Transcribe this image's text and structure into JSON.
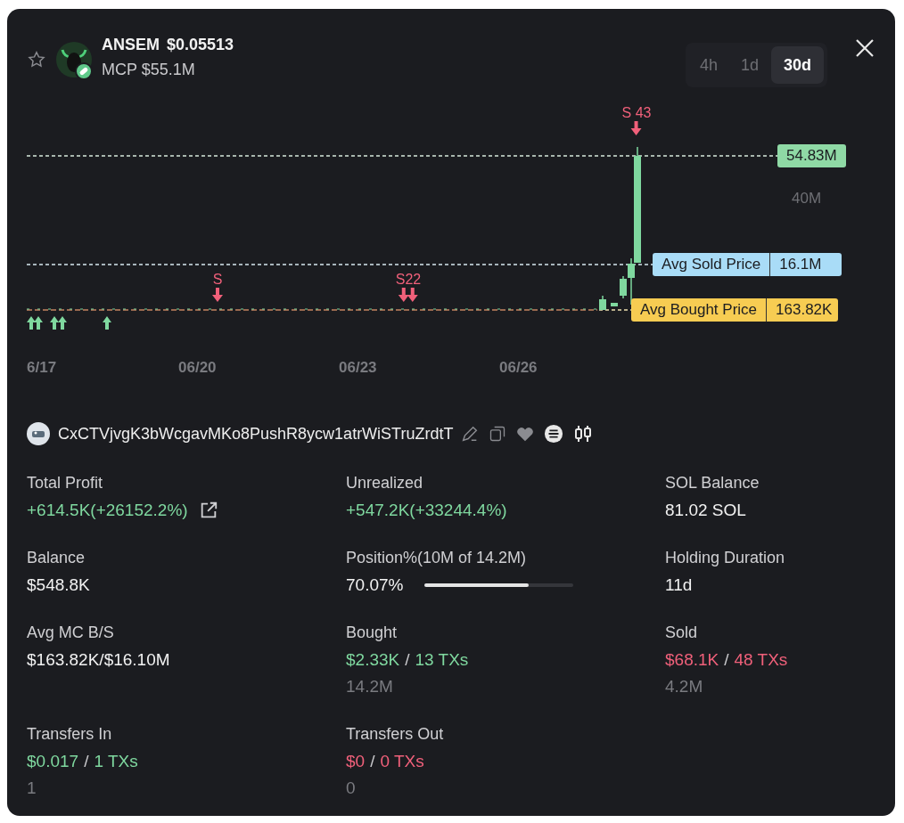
{
  "header": {
    "symbol": "ANSEM",
    "price": "$0.05513",
    "market_cap": "MCP $55.1M"
  },
  "timeframes": [
    {
      "label": "4h",
      "selected": false
    },
    {
      "label": "1d",
      "selected": false
    },
    {
      "label": "30d",
      "selected": true
    }
  ],
  "chart": {
    "sell_markers": [
      {
        "label": "S 43"
      },
      {
        "label": "S"
      },
      {
        "label": "S22"
      }
    ],
    "y_axis_label": "40M",
    "price_tags": [
      {
        "kind": "current",
        "value": "54.83M"
      },
      {
        "kind": "avg_sold",
        "name": "Avg Sold Price",
        "value": "16.1M"
      },
      {
        "kind": "avg_bought",
        "name": "Avg Bought Price",
        "value": "163.82K"
      }
    ],
    "dates": [
      "6/17",
      "06/20",
      "06/23",
      "06/26"
    ]
  },
  "wallet": {
    "address": "CxCTVjvgK3bWcgavMKo8PushR8ycw1atrWiSTruZrdtT"
  },
  "stats": [
    {
      "label": "Total Profit",
      "kind": "link",
      "parts": [
        {
          "text": "+614.5K(+26152.2%)",
          "color": "#7fd89f"
        }
      ]
    },
    {
      "label": "Unrealized",
      "kind": "plain",
      "parts": [
        {
          "text": "+547.2K(+33244.4%)",
          "color": "#7fd89f"
        }
      ]
    },
    {
      "label": "SOL Balance",
      "kind": "plain",
      "parts": [
        {
          "text": "81.02 SOL",
          "color": "#f2f2f2"
        }
      ]
    },
    {
      "label": "Balance",
      "kind": "plain",
      "parts": [
        {
          "text": "$548.8K",
          "color": "#f2f2f2"
        }
      ]
    },
    {
      "label": "Position%(10M of 14.2M)",
      "kind": "progress",
      "level": 0.7,
      "parts": [
        {
          "text": "70.07%",
          "color": "#f2f2f2"
        }
      ]
    },
    {
      "label": "Holding Duration",
      "kind": "plain",
      "parts": [
        {
          "text": "11d",
          "color": "#f2f2f2"
        }
      ]
    },
    {
      "label": "Avg MC B/S",
      "kind": "plain",
      "parts": [
        {
          "text": "$163.82K/$16.10M",
          "color": "#f2f2f2"
        }
      ]
    },
    {
      "label": "Bought",
      "kind": "plain",
      "parts": [
        {
          "text": "$2.33K",
          "color": "#7fd89f"
        },
        {
          "text": "/",
          "color": "#c9c9cc"
        },
        {
          "text": "13 TXs",
          "color": "#7fd89f"
        }
      ],
      "sub": "14.2M"
    },
    {
      "label": "Sold",
      "kind": "plain",
      "parts": [
        {
          "text": "$68.1K",
          "color": "#f0607a"
        },
        {
          "text": "/",
          "color": "#c9c9cc"
        },
        {
          "text": "48 TXs",
          "color": "#f0607a"
        }
      ],
      "sub": "4.2M"
    },
    {
      "label": "Transfers In",
      "kind": "plain",
      "parts": [
        {
          "text": "$0.017",
          "color": "#7fd89f"
        },
        {
          "text": "/",
          "color": "#c9c9cc"
        },
        {
          "text": "1 TXs",
          "color": "#7fd89f"
        }
      ],
      "sub": "1"
    },
    {
      "label": "Transfers Out",
      "kind": "plain",
      "parts": [
        {
          "text": "$0",
          "color": "#f0607a"
        },
        {
          "text": "/",
          "color": "#c9c9cc"
        },
        {
          "text": "0 TXs",
          "color": "#f0607a"
        }
      ],
      "sub": "0"
    }
  ]
}
